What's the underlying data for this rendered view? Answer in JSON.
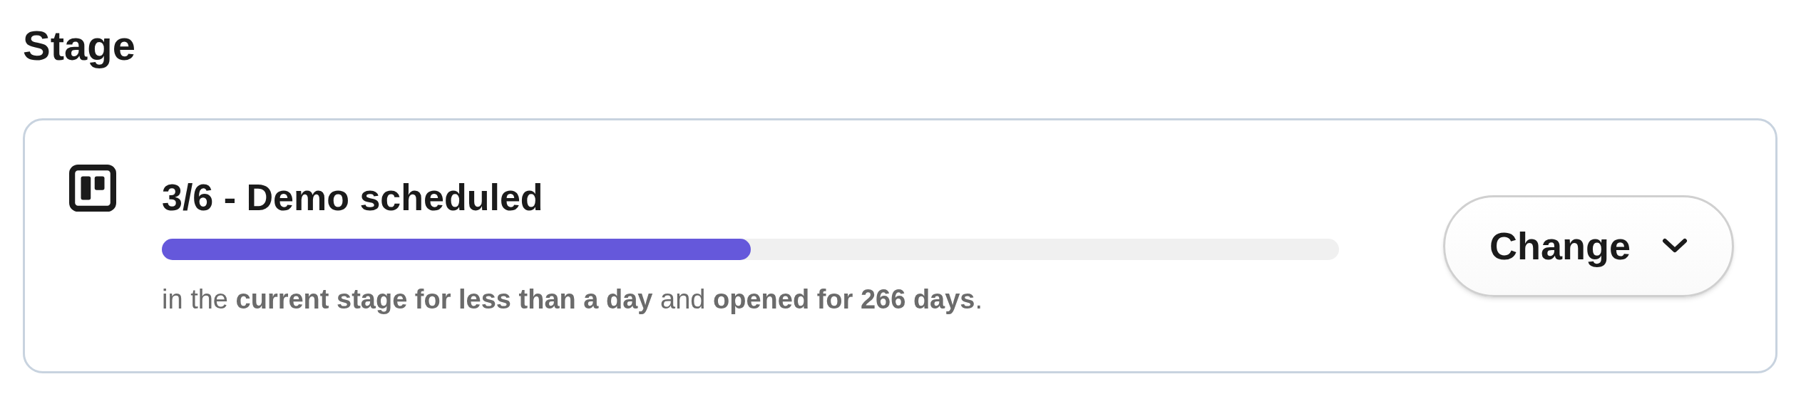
{
  "section_title": "Stage",
  "stage": {
    "title": "3/6 - Demo scheduled",
    "level": 0.5,
    "summary": "in the **current stage for less than a day** and **opened for 266 days**."
  },
  "button": {
    "label": "Change"
  }
}
